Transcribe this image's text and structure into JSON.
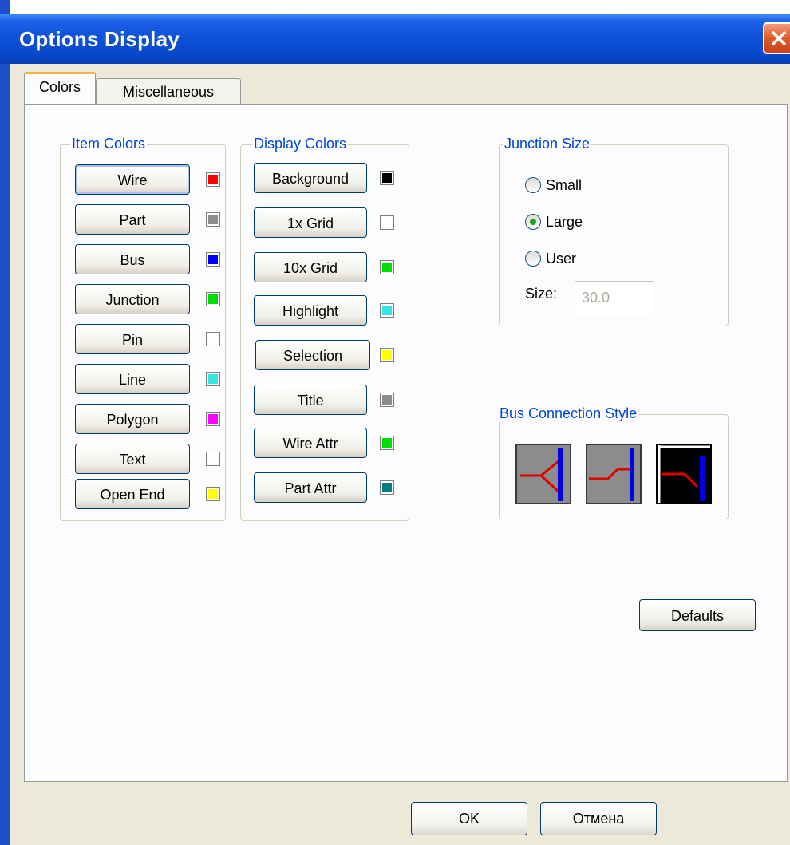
{
  "window": {
    "title": "Options Display"
  },
  "tabs": [
    {
      "label": "Colors",
      "active": true
    },
    {
      "label": "Miscellaneous",
      "active": false
    }
  ],
  "item_colors": {
    "title": "Item Colors",
    "items": [
      {
        "label": "Wire",
        "color": "#ff0000"
      },
      {
        "label": "Part",
        "color": "#8c8c8c"
      },
      {
        "label": "Bus",
        "color": "#0000ff"
      },
      {
        "label": "Junction",
        "color": "#00e000"
      },
      {
        "label": "Pin",
        "color": "#ffffff"
      },
      {
        "label": "Line",
        "color": "#33e6e6"
      },
      {
        "label": "Polygon",
        "color": "#ff00ff"
      },
      {
        "label": "Text",
        "color": "#ffffff"
      },
      {
        "label": "Open End",
        "color": "#ffff00"
      }
    ]
  },
  "display_colors": {
    "title": "Display Colors",
    "items": [
      {
        "label": "Background",
        "color": "#000000"
      },
      {
        "label": "1x Grid",
        "color": "#ffffff"
      },
      {
        "label": "10x Grid",
        "color": "#00e000"
      },
      {
        "label": "Highlight",
        "color": "#33e6e6"
      },
      {
        "label": "Selection",
        "color": "#ffff00"
      },
      {
        "label": "Title",
        "color": "#8c8c8c"
      },
      {
        "label": "Wire Attr",
        "color": "#00e000"
      },
      {
        "label": "Part Attr",
        "color": "#008080"
      }
    ]
  },
  "junction_size": {
    "title": "Junction Size",
    "options": [
      {
        "label": "Small",
        "selected": false
      },
      {
        "label": "Large",
        "selected": true
      },
      {
        "label": "User",
        "selected": false
      }
    ],
    "size_label": "Size:",
    "size_value": "30.0"
  },
  "bus_connection": {
    "title": "Bus Connection Style",
    "styles": [
      "branch",
      "step",
      "angled"
    ]
  },
  "buttons": {
    "defaults": "Defaults",
    "ok": "OK",
    "cancel": "Отмена"
  }
}
